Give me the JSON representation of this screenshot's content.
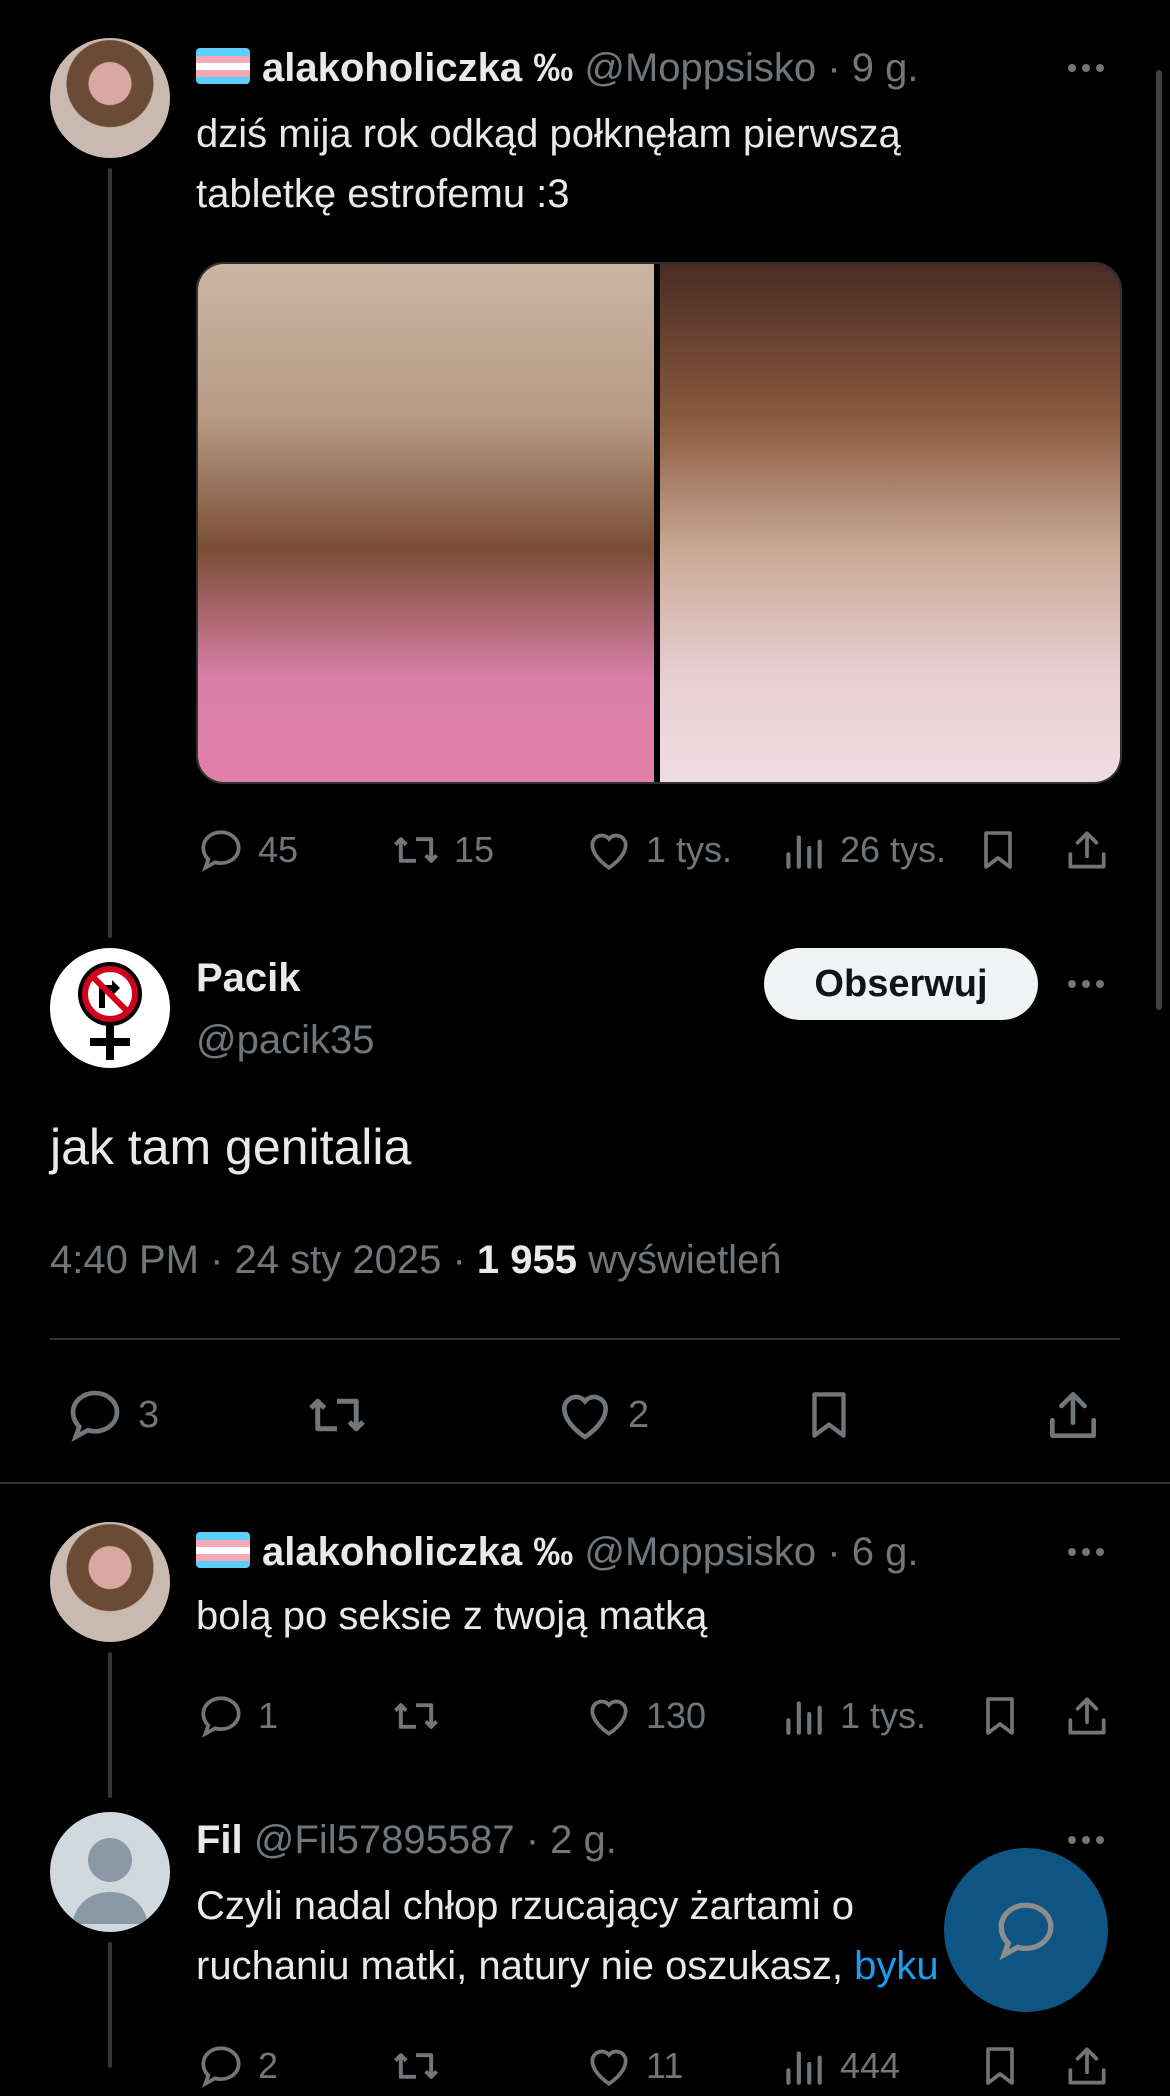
{
  "tweets": [
    {
      "name": "alakoholiczka ‰",
      "handle": "@Moppsisko",
      "time": "· 9 g.",
      "text_line1": "dziś mija rok odkąd połknęłam pierwszą",
      "text_line2": "tabletkę estrofemu :3",
      "replies": "45",
      "retweets": "15",
      "likes": "1 tys.",
      "views": "26 tys."
    },
    {
      "name": "alakoholiczka ‰",
      "handle": "@Moppsisko",
      "time": "· 6 g.",
      "text": "bolą po seksie z twoją matką",
      "replies": "1",
      "retweets": "",
      "likes": "130",
      "views": "1 tys."
    },
    {
      "name": "Fil",
      "handle": "@Fil57895587",
      "time": "· 2 g.",
      "text_line1": "Czyli nadal chłop rzucający żartami o",
      "text_line2_a": "ruchaniu matki, natury nie oszukasz, ",
      "text_line2_b": "byku",
      "replies": "2",
      "likes": "11",
      "views": "444"
    }
  ],
  "focused": {
    "name": "Pacik",
    "handle": "@pacik35",
    "follow_label": "Obserwuj",
    "text": "jak tam genitalia",
    "time": "4:40 PM",
    "date": "24 sty 2025",
    "views_count": "1 955",
    "views_label": "wyświetleń",
    "replies": "3",
    "likes": "2"
  },
  "colors": {
    "background": "#000000",
    "text": "#e7e9ea",
    "muted": "#71767b",
    "link": "#1d9bf0",
    "trans_flag": [
      "#5BCEFA",
      "#F5A9B8",
      "#FFFFFF",
      "#F5A9B8",
      "#5BCEFA"
    ]
  },
  "icons": [
    "reply-icon",
    "retweet-icon",
    "like-icon",
    "views-icon",
    "bookmark-icon",
    "share-icon",
    "more-icon",
    "compose-reply-icon"
  ]
}
